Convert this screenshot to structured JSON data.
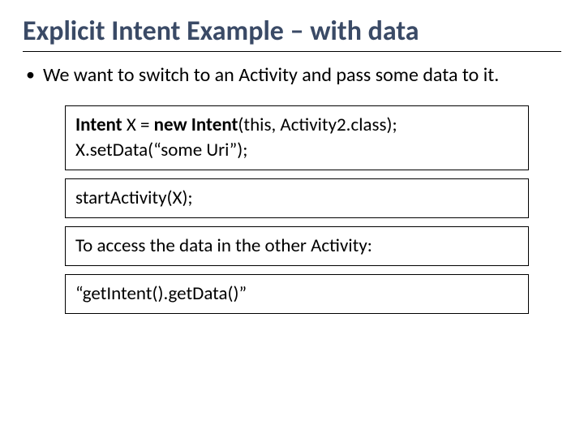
{
  "slide": {
    "title": "Explicit Intent Example – with data",
    "bullet": "We want to switch to an Activity and pass some data to it.",
    "code1": {
      "kw1": "Intent",
      "mid1": " X = ",
      "kw2": "new Intent",
      "tail1": "(this, Activity2.class);",
      "line2": "X.setData(“some Uri”);"
    },
    "code2": "startActivity(X);",
    "note": "To access the data in the other Activity:",
    "code3": "“getIntent().getData()”"
  }
}
